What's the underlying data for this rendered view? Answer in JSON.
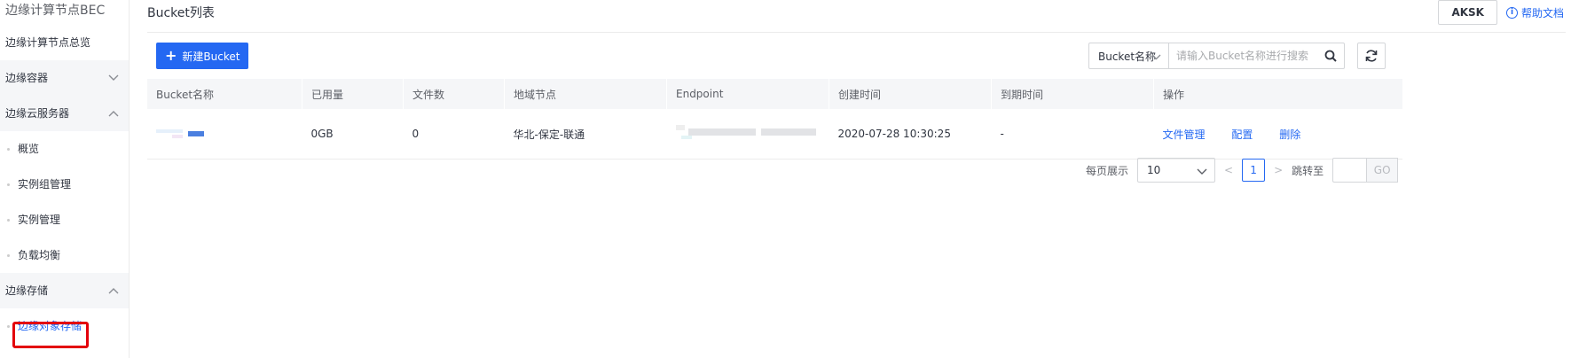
{
  "sidebar": {
    "title": "边缘计算节点BEC",
    "items": [
      {
        "label": "边缘计算节点总览",
        "type": "item"
      },
      {
        "label": "边缘容器",
        "type": "group",
        "expanded": false
      },
      {
        "label": "边缘云服务器",
        "type": "group",
        "expanded": true
      },
      {
        "label": "概览",
        "type": "sub"
      },
      {
        "label": "实例组管理",
        "type": "sub"
      },
      {
        "label": "实例管理",
        "type": "sub"
      },
      {
        "label": "负载均衡",
        "type": "sub"
      },
      {
        "label": "边缘存储",
        "type": "group",
        "expanded": true
      },
      {
        "label": "边缘对象存储",
        "type": "sub",
        "active": true
      }
    ]
  },
  "header": {
    "title": "Bucket列表",
    "aksk_label": "AKSK",
    "help_label": "帮助文档"
  },
  "toolbar": {
    "create_label": "新建Bucket",
    "search_field": "Bucket名称",
    "search_placeholder": "请输入Bucket名称进行搜索"
  },
  "table": {
    "columns": [
      "Bucket名称",
      "已用量",
      "文件数",
      "地域节点",
      "Endpoint",
      "创建时间",
      "到期时间",
      "操作"
    ],
    "rows": [
      {
        "used": "0GB",
        "files": "0",
        "region": "华北-保定-联通",
        "created": "2020-07-28 10:30:25",
        "expires": "-",
        "actions": [
          "文件管理",
          "配置",
          "删除"
        ]
      }
    ]
  },
  "pager": {
    "page_size_label": "每页展示",
    "page_size": "10",
    "prev": "<",
    "current_page": "1",
    "next": ">",
    "jump_label": "跳转至",
    "go_label": "GO"
  },
  "colors": {
    "accent": "#2468f2",
    "highlight": "#e3000b"
  }
}
